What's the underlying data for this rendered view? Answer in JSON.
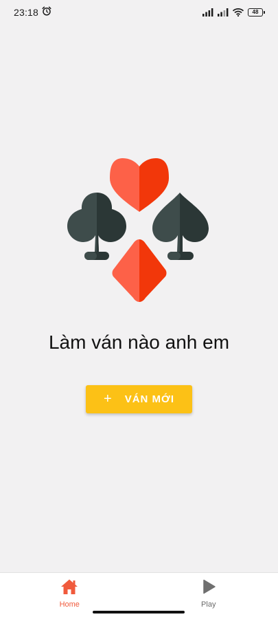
{
  "status_bar": {
    "time": "23:18",
    "battery_level": "48"
  },
  "main": {
    "headline": "Làm ván nào anh em",
    "new_game_button": {
      "icon": "plus-icon",
      "icon_glyph": "+",
      "label": "VÁN MỚI"
    },
    "illustration": {
      "suits": [
        "heart-icon",
        "club-icon",
        "spade-icon",
        "diamond-icon"
      ]
    }
  },
  "bottom_nav": {
    "items": [
      {
        "label": "Home",
        "icon": "home-icon",
        "active": true
      },
      {
        "label": "Play",
        "icon": "play-icon",
        "active": false
      }
    ]
  },
  "colors": {
    "accent": "#f05a3c",
    "button": "#fcc116",
    "suit_red_light": "#fd6148",
    "suit_red_dark": "#f2370a",
    "suit_dark_light": "#3e4c4b",
    "suit_dark_dark": "#2b3736",
    "background": "#f2f1f2"
  }
}
